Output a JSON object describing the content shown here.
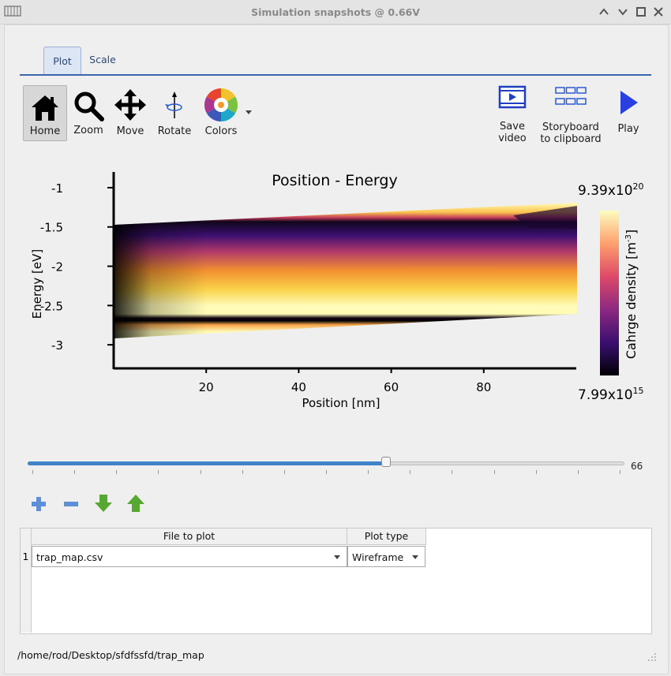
{
  "window": {
    "title": "Simulation snapshots @ 0.66V"
  },
  "tabs": [
    {
      "label": "Plot",
      "active": true
    },
    {
      "label": "Scale",
      "active": false
    }
  ],
  "toolbar": {
    "home": "Home",
    "zoom": "Zoom",
    "move": "Move",
    "rotate": "Rotate",
    "colors": "Colors",
    "save_video_1": "Save",
    "save_video_2": "video",
    "storyboard_1": "Storyboard",
    "storyboard_2": "to clipboard",
    "play": "Play"
  },
  "plot": {
    "title": "Position - Energy",
    "xlabel": "Position [nm]",
    "ylabel": "Energy [eV]",
    "xticks": [
      "20",
      "40",
      "60",
      "80"
    ],
    "yticks": [
      "-1",
      "-1.5",
      "-2",
      "-2.5",
      "-3"
    ],
    "colorbar_label_main": "Cahrge density [m",
    "colorbar_label_sup": "-3",
    "colorbar_label_end": "]",
    "colorbar_max_base": "9.39x10",
    "colorbar_max_exp": "20",
    "colorbar_min_base": "7.99x10",
    "colorbar_min_exp": "15"
  },
  "chart_data": {
    "type": "heatmap",
    "title": "Position - Energy",
    "xlabel": "Position [nm]",
    "ylabel": "Energy [eV]",
    "xlim": [
      0,
      100
    ],
    "ylim": [
      -3.3,
      -0.8
    ],
    "colorbar": {
      "label": "Cahrge density [m-3]",
      "min": "7.99x10^15",
      "max": "9.39x10^20",
      "colormap": "inferno"
    },
    "band_edges": {
      "x": [
        0,
        100
      ],
      "upper_edge": [
        -1.47,
        -1.23
      ],
      "lower_edge": [
        -2.9,
        -2.58
      ],
      "conduction_dark_edge": [
        -1.8,
        -1.25
      ],
      "valence_dark_edge": [
        -2.68,
        -2.45
      ]
    }
  },
  "slider": {
    "value": "66",
    "fraction": 0.6
  },
  "table": {
    "headers": [
      "File to plot",
      "Plot type"
    ],
    "rows": [
      {
        "num": "1",
        "file": "trap_map.csv",
        "type": "Wireframe"
      }
    ]
  },
  "status": {
    "path": "/home/rod/Desktop/sfdfssfd/trap_map"
  },
  "colors": {
    "accent": "#3a66b0",
    "slider_fill": "#3f84c8"
  }
}
